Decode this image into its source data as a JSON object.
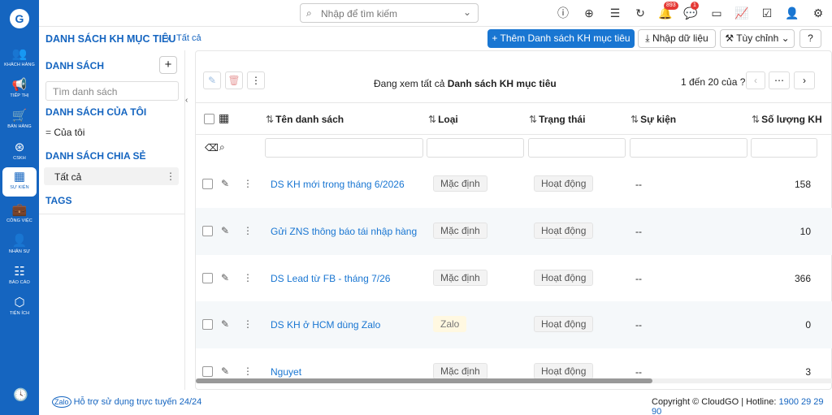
{
  "rail": {
    "items": [
      {
        "icon": "customers-icon",
        "label": "KHÁCH HÀNG",
        "glyph": "👥"
      },
      {
        "icon": "marketing-icon",
        "label": "TIẾP THỊ",
        "glyph": "📢"
      },
      {
        "icon": "sales-icon",
        "label": "BÁN HÀNG",
        "glyph": "🛒"
      },
      {
        "icon": "support-icon",
        "label": "CSKH",
        "glyph": "⊛"
      },
      {
        "icon": "events-icon",
        "label": "SỰ KIỆN",
        "glyph": "▦"
      },
      {
        "icon": "tasks-icon",
        "label": "CÔNG VIỆC",
        "glyph": "💼"
      },
      {
        "icon": "staff-icon",
        "label": "NHÂN SỰ",
        "glyph": "👤"
      },
      {
        "icon": "reports-icon",
        "label": "BÁO CÁO",
        "glyph": "☷"
      },
      {
        "icon": "utilities-icon",
        "label": "TIỆN ÍCH",
        "glyph": "⬡"
      }
    ]
  },
  "topbar": {
    "search_placeholder": "Nhập để tìm kiếm",
    "notif_count": "893",
    "chat_count": "1"
  },
  "header": {
    "title": "DANH SÁCH KH MỤC TIÊU",
    "breadcrumb": "Tất cả",
    "add_button": "+ Thêm Danh sách KH mục tiêu",
    "import_button": "Nhập dữ liệu",
    "custom_button": "Tùy chỉnh"
  },
  "left": {
    "section_lists": "DANH SÁCH",
    "search_placeholder": "Tìm danh sách",
    "section_mine": "DANH SÁCH CỦA TÔI",
    "mine_item": "Của tôi",
    "section_shared": "DANH SÁCH CHIA SẺ",
    "shared_item": "Tất cả",
    "section_tags": "TAGS"
  },
  "toolbar": {
    "viewing_prefix": "Đang xem tất cả ",
    "viewing_bold": "Danh sách KH mục tiêu",
    "pager": "1 đến 20 của ?"
  },
  "table": {
    "columns": [
      "Tên danh sách",
      "Loại",
      "Trạng thái",
      "Sự kiện",
      "Số lượng KH"
    ],
    "rows": [
      {
        "name": "DS KH mới trong tháng 6/2026",
        "type": "Mặc định",
        "status": "Hoạt động",
        "event": "--",
        "count": "158"
      },
      {
        "name": "Gửi ZNS thông báo tái nhập hàng",
        "type": "Mặc định",
        "status": "Hoạt động",
        "event": "--",
        "count": "10"
      },
      {
        "name": "DS Lead từ FB - tháng 7/26",
        "type": "Mặc định",
        "status": "Hoạt động",
        "event": "--",
        "count": "366"
      },
      {
        "name": "DS KH ở HCM dùng Zalo",
        "type": "Zalo",
        "status": "Hoạt động",
        "event": "--",
        "count": "0"
      },
      {
        "name": "Nguyet",
        "type": "Mặc định",
        "status": "Hoạt động",
        "event": "--",
        "count": "3"
      }
    ]
  },
  "footer": {
    "support": "Hỗ trợ sử dụng trực tuyến 24/24",
    "copyright": "Copyright © CloudGO | Hotline: ",
    "hotline": "1900 29 29 90"
  }
}
